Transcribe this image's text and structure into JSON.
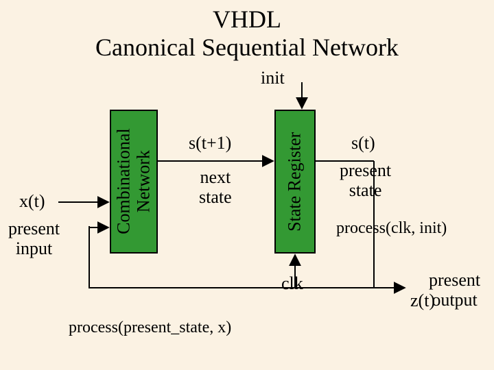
{
  "title_line1": "VHDL",
  "title_line2": "Canonical Sequential Network",
  "labels": {
    "init": "init",
    "comb_block": "Combinational\nNetwork",
    "state_block": "State Register",
    "xt": "x(t)",
    "present_input": "present\ninput",
    "stp1": "s(t+1)",
    "next_state": "next\nstate",
    "st": "s(t)",
    "present_state": "present\nstate",
    "proc_clk": "process(clk, init)",
    "clk": "clk",
    "zt": "z(t)",
    "present_output": "present\noutput",
    "proc_ps": "process(present_state, x)"
  }
}
